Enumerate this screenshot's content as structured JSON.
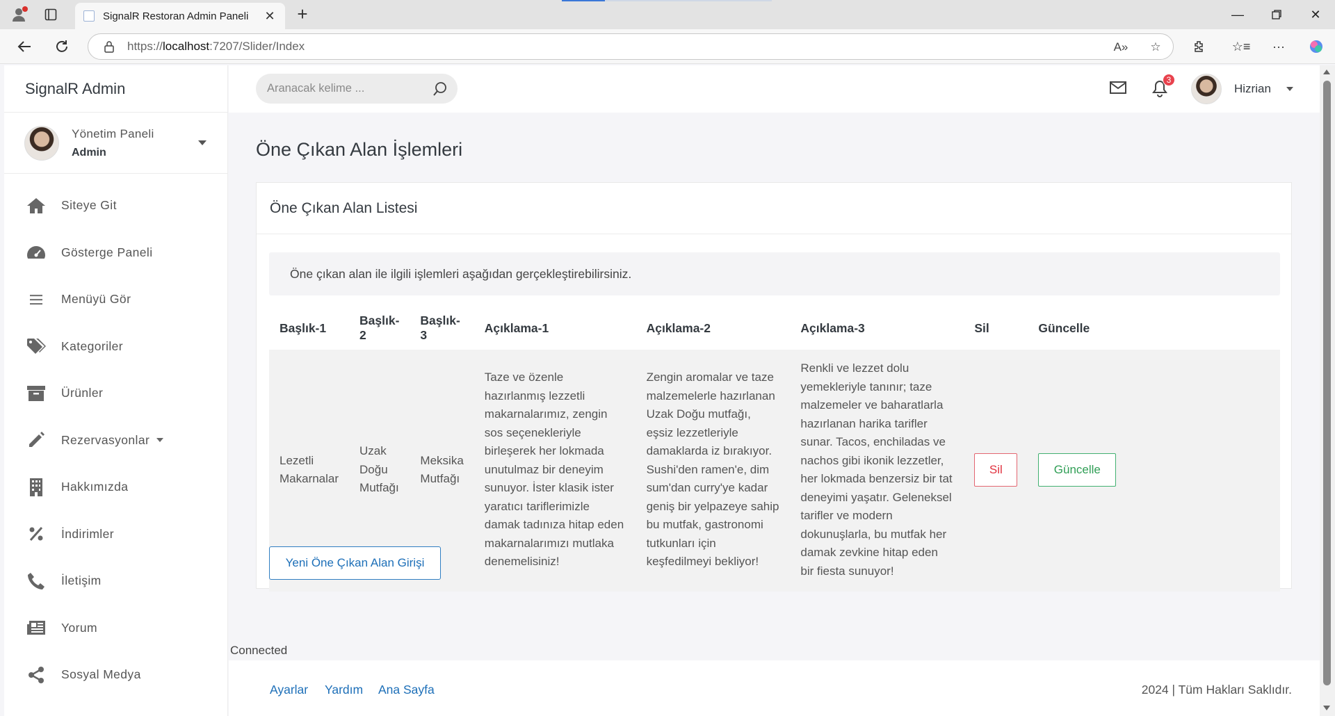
{
  "browser": {
    "tab_title": "SignalR Restoran Admin Paneli",
    "url_prefix": "https://",
    "url_host": "localhost",
    "url_rest": ":7207/Slider/Index"
  },
  "sidebar": {
    "brand": "SignalR Admin",
    "user_title": "Yönetim Paneli",
    "user_role": "Admin",
    "items": [
      {
        "label": "Siteye Git",
        "icon": "home-icon"
      },
      {
        "label": "Gösterge Paneli",
        "icon": "gauge-icon"
      },
      {
        "label": "Menüyü Gör",
        "icon": "list-icon"
      },
      {
        "label": "Kategoriler",
        "icon": "tags-icon"
      },
      {
        "label": "Ürünler",
        "icon": "archive-icon"
      },
      {
        "label": "Rezervasyonlar",
        "icon": "pencil-icon",
        "has_dropdown": true
      },
      {
        "label": "Hakkımızda",
        "icon": "building-icon"
      },
      {
        "label": "İndirimler",
        "icon": "percent-icon"
      },
      {
        "label": "İletişim",
        "icon": "phone-icon"
      },
      {
        "label": "Yorum",
        "icon": "newspaper-icon"
      },
      {
        "label": "Sosyal Medya",
        "icon": "share-icon"
      }
    ]
  },
  "topbar": {
    "search_placeholder": "Aranacak kelime ...",
    "notification_count": "3",
    "user_name": "Hizrian"
  },
  "page": {
    "title": "Öne Çıkan Alan İşlemleri",
    "card_title": "Öne Çıkan Alan Listesi",
    "info_text": "Öne çıkan alan ile ilgili işlemleri aşağıdan gerçekleştirebilirsiniz.",
    "new_button": "Yeni Öne Çıkan Alan Girişi"
  },
  "table": {
    "headers": [
      "Başlık-1",
      "Başlık-2",
      "Başlık-3",
      "Açıklama-1",
      "Açıklama-2",
      "Açıklama-3",
      "Sil",
      "Güncelle"
    ],
    "rows": [
      {
        "title1": "Lezetli Makarnalar",
        "title2": "Uzak Doğu Mutfağı",
        "title3": "Meksika Mutfağı",
        "desc1": "Taze ve özenle hazırlanmış lezzetli makarnalarımız, zengin sos seçenekleriyle birleşerek her lokmada unutulmaz bir deneyim sunuyor. İster klasik ister yaratıcı tariflerimizle damak tadınıza hitap eden makarnalarımızı mutlaka denemelisiniz!",
        "desc2": "Zengin aromalar ve taze malzemelerle hazırlanan Uzak Doğu mutfağı, eşsiz lezzetleriyle damaklarda iz bırakıyor. Sushi'den ramen'e, dim sum'dan curry'ye kadar geniş bir yelpazeye sahip bu mutfak, gastronomi tutkunları için keşfedilmeyi bekliyor!",
        "desc3": "Renkli ve lezzet dolu yemekleriyle tanınır; taze malzemeler ve baharatlarla hazırlanan harika tarifler sunar. Tacos, enchiladas ve nachos gibi ikonik lezzetler, her lokmada benzersiz bir tat deneyimi yaşatır. Geleneksel tarifler ve modern dokunuşlarla, bu mutfak her damak zevkine hitap eden bir fiesta sunuyor!",
        "delete_label": "Sil",
        "update_label": "Güncelle"
      }
    ]
  },
  "status_text": "Connected",
  "footer": {
    "links": [
      "Ayarlar",
      "Yardım",
      "Ana Sayfa"
    ],
    "copyright": "2024 | Tüm Hakları Saklıdır."
  }
}
